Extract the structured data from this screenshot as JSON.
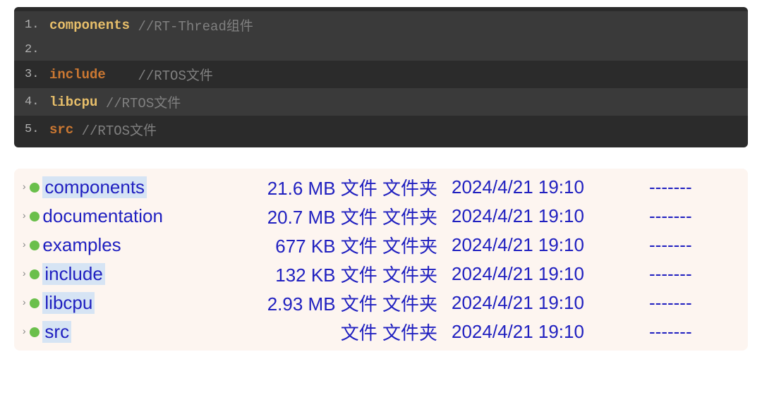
{
  "code": {
    "lines": [
      {
        "num": "1.",
        "keyword": "components",
        "spacing": " ",
        "comment": "//RT-Thread组件",
        "highlighted": true,
        "kw_class": "keyword-yellow"
      },
      {
        "num": "2.",
        "keyword": "",
        "spacing": "",
        "comment": "",
        "highlighted": true,
        "kw_class": ""
      },
      {
        "num": "3.",
        "keyword": "include",
        "spacing": "    ",
        "comment": "//RTOS文件",
        "highlighted": false,
        "kw_class": "keyword"
      },
      {
        "num": "4.",
        "keyword": "libcpu",
        "spacing": " ",
        "comment": "//RTOS文件",
        "highlighted": true,
        "kw_class": "keyword-yellow"
      },
      {
        "num": "5.",
        "keyword": "src",
        "spacing": " ",
        "comment": "//RTOS文件",
        "highlighted": false,
        "kw_class": "keyword"
      }
    ]
  },
  "files": {
    "type_label": "文件 文件夹",
    "attr_label": "-------",
    "rows": [
      {
        "name": "components",
        "size": "21.6 MB",
        "date": "2024/4/21 19:10",
        "selected": true
      },
      {
        "name": "documentation",
        "size": "20.7 MB",
        "date": "2024/4/21 19:10",
        "selected": false
      },
      {
        "name": "examples",
        "size": "677 KB",
        "date": "2024/4/21 19:10",
        "selected": false
      },
      {
        "name": "include",
        "size": "132 KB",
        "date": "2024/4/21 19:10",
        "selected": true
      },
      {
        "name": "libcpu",
        "size": "2.93 MB",
        "date": "2024/4/21 19:10",
        "selected": true
      },
      {
        "name": "src",
        "size": "",
        "date": "2024/4/21 19:10",
        "selected": true
      }
    ]
  }
}
